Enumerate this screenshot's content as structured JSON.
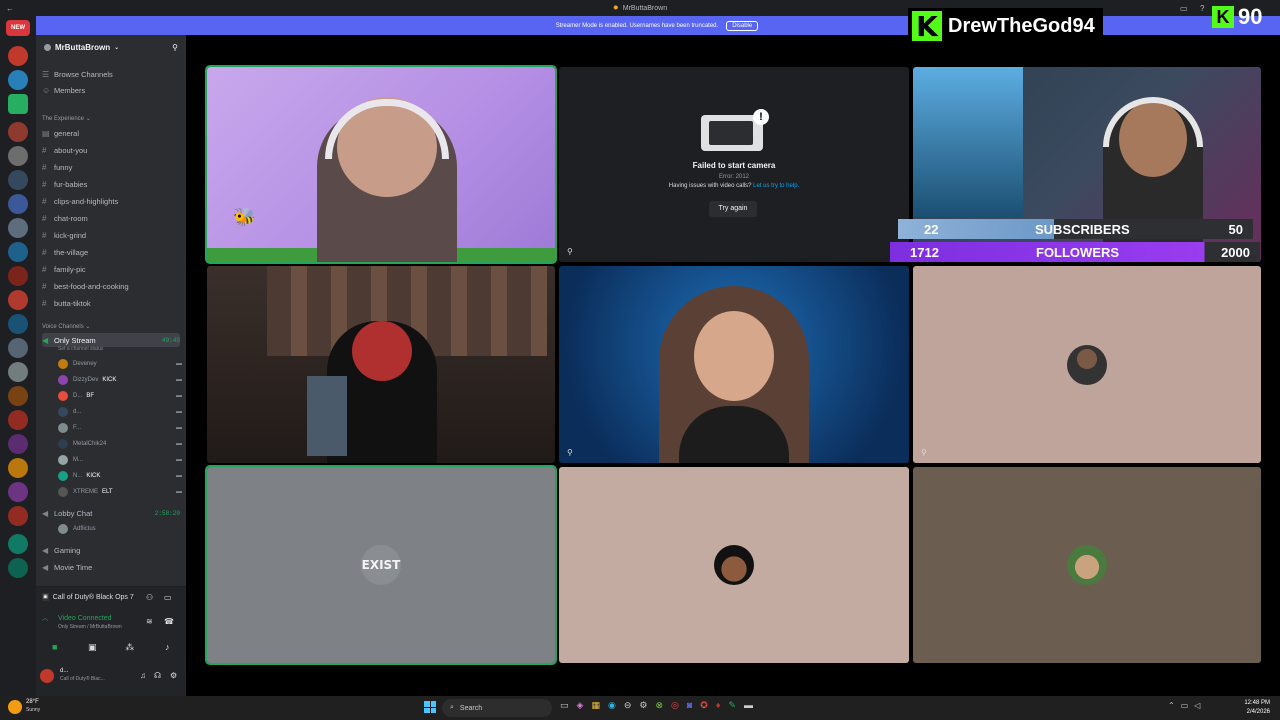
{
  "window": {
    "title": "MrButtaBrown"
  },
  "banner": {
    "text": "Streamer Mode is enabled. Usernames have been truncated.",
    "button": "Disable"
  },
  "guild_badge": "NEW",
  "server": {
    "name": "MrButtaBrown",
    "browse": "Browse Channels",
    "members": "Members",
    "category_text": "The Experience",
    "channels": [
      "general",
      "about-you",
      "funny",
      "fur-babies",
      "clips-and-highlights",
      "chat-room",
      "kick-grind",
      "the-village",
      "family-pic",
      "best-food-and-cooking",
      "butta-tiktok"
    ],
    "category_voice": "Voice Channels",
    "voice_channel": {
      "name": "Only Stream",
      "time": "49:49",
      "status": "Set a channel status"
    },
    "voice_users": [
      {
        "name": "Deveney",
        "tag": "",
        "color": "#c27c0e"
      },
      {
        "name": "DizzyDev",
        "tag": "KICK",
        "color": "#8e44ad"
      },
      {
        "name": "D...",
        "tag": "BF",
        "color": "#e74c3c"
      },
      {
        "name": "d...",
        "tag": "",
        "color": "#34495e"
      },
      {
        "name": "F...",
        "tag": "",
        "color": "#7f8c8d"
      },
      {
        "name": "MetalChik24",
        "tag": "",
        "color": "#2c3e50"
      },
      {
        "name": "M...",
        "tag": "",
        "color": "#95a5a6"
      },
      {
        "name": "N...",
        "tag": "KICK",
        "color": "#16a085"
      },
      {
        "name": "XTREME",
        "tag": "ELT",
        "color": "#555555"
      }
    ],
    "lobby": {
      "name": "Lobby Chat",
      "time": "2:58:20",
      "user": "Adflictus"
    },
    "gaming": "Gaming",
    "movie": "Movie Time"
  },
  "activity": {
    "game": "Call of Duty® Black Ops 7"
  },
  "voice_status": {
    "title": "Video Connected",
    "sub": "Only Stream / MrButtaBrown"
  },
  "user_panel": {
    "name": "d...",
    "status": "Call of Duty® Blac..."
  },
  "camera_error": {
    "title": "Failed to start camera",
    "error": "Error: 2012",
    "help": "Having issues with video calls?",
    "link": "Let us try to help.",
    "button": "Try again"
  },
  "overlay": {
    "streamer": "DrewTheGod94",
    "kick_count": "90",
    "subs_current": "22",
    "subs_label": "SUBSCRIBERS",
    "subs_goal": "50",
    "followers_current": "1712",
    "followers_label": "FOLLOWERS",
    "followers_goal": "2000"
  },
  "tile_text": {
    "exist": "EXIST"
  },
  "taskbar": {
    "weather_temp": "28°F",
    "weather_desc": "Sunny",
    "search": "Search",
    "time": "12:48 PM",
    "date": "2/4/2026"
  },
  "colors": {
    "blurple": "#5865f2",
    "kick_green": "#53fc18",
    "speaking": "#23a55a"
  }
}
